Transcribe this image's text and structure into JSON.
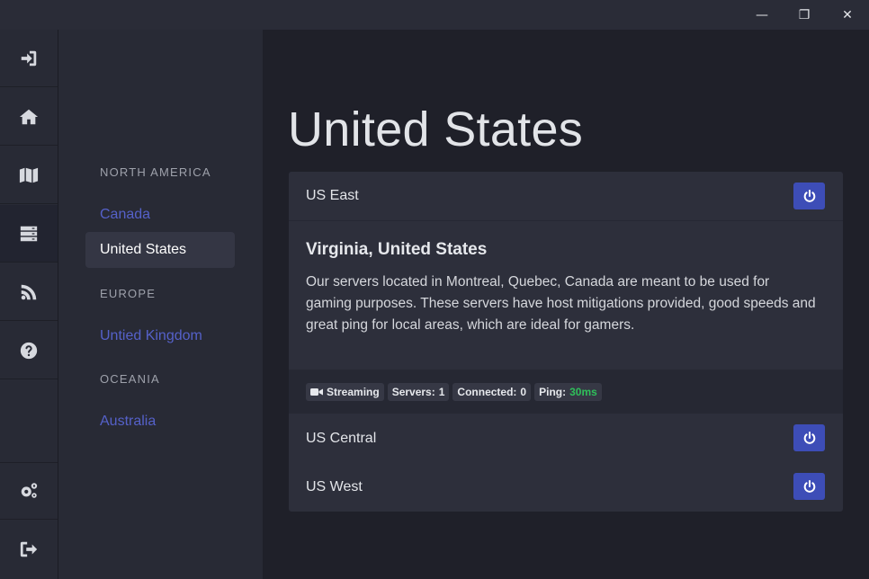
{
  "window": {
    "minimize_glyph": "—",
    "maximize_glyph": "❐",
    "close_glyph": "✕"
  },
  "iconbar": {
    "items": [
      {
        "icon": "sign-in-icon"
      },
      {
        "icon": "home-icon"
      },
      {
        "icon": "map-icon"
      },
      {
        "icon": "servers-icon",
        "active": true
      },
      {
        "icon": "feed-icon"
      },
      {
        "icon": "help-icon"
      },
      {
        "icon": "settings-icon"
      },
      {
        "icon": "sign-out-icon"
      }
    ]
  },
  "regions": {
    "north_america": {
      "heading": "NORTH AMERICA",
      "items": [
        "Canada",
        "United States"
      ]
    },
    "europe": {
      "heading": "EUROPE",
      "items": [
        "Untied Kingdom"
      ]
    },
    "oceania": {
      "heading": "OCEANIA",
      "items": [
        "Australia"
      ]
    },
    "selected": "United States"
  },
  "main": {
    "title": "United States",
    "servers": [
      {
        "name": "US East",
        "expanded": true
      },
      {
        "name": "US Central"
      },
      {
        "name": "US West"
      }
    ],
    "detail": {
      "title": "Virginia, United States",
      "description": "Our servers located in Montreal, Quebec, Canada are meant to be used for gaming purposes. These servers have host mitigations provided, good speeds and great ping for local areas, which are ideal for gamers."
    },
    "badges": {
      "streaming": "Streaming",
      "servers_label": "Servers:",
      "servers_value": "1",
      "connected_label": "Connected:",
      "connected_value": "0",
      "ping_label": "Ping:",
      "ping_value": "30ms"
    }
  },
  "colors": {
    "accent": "#3d4db7",
    "link": "#5561c9",
    "ping_good": "#2fbf5a"
  }
}
